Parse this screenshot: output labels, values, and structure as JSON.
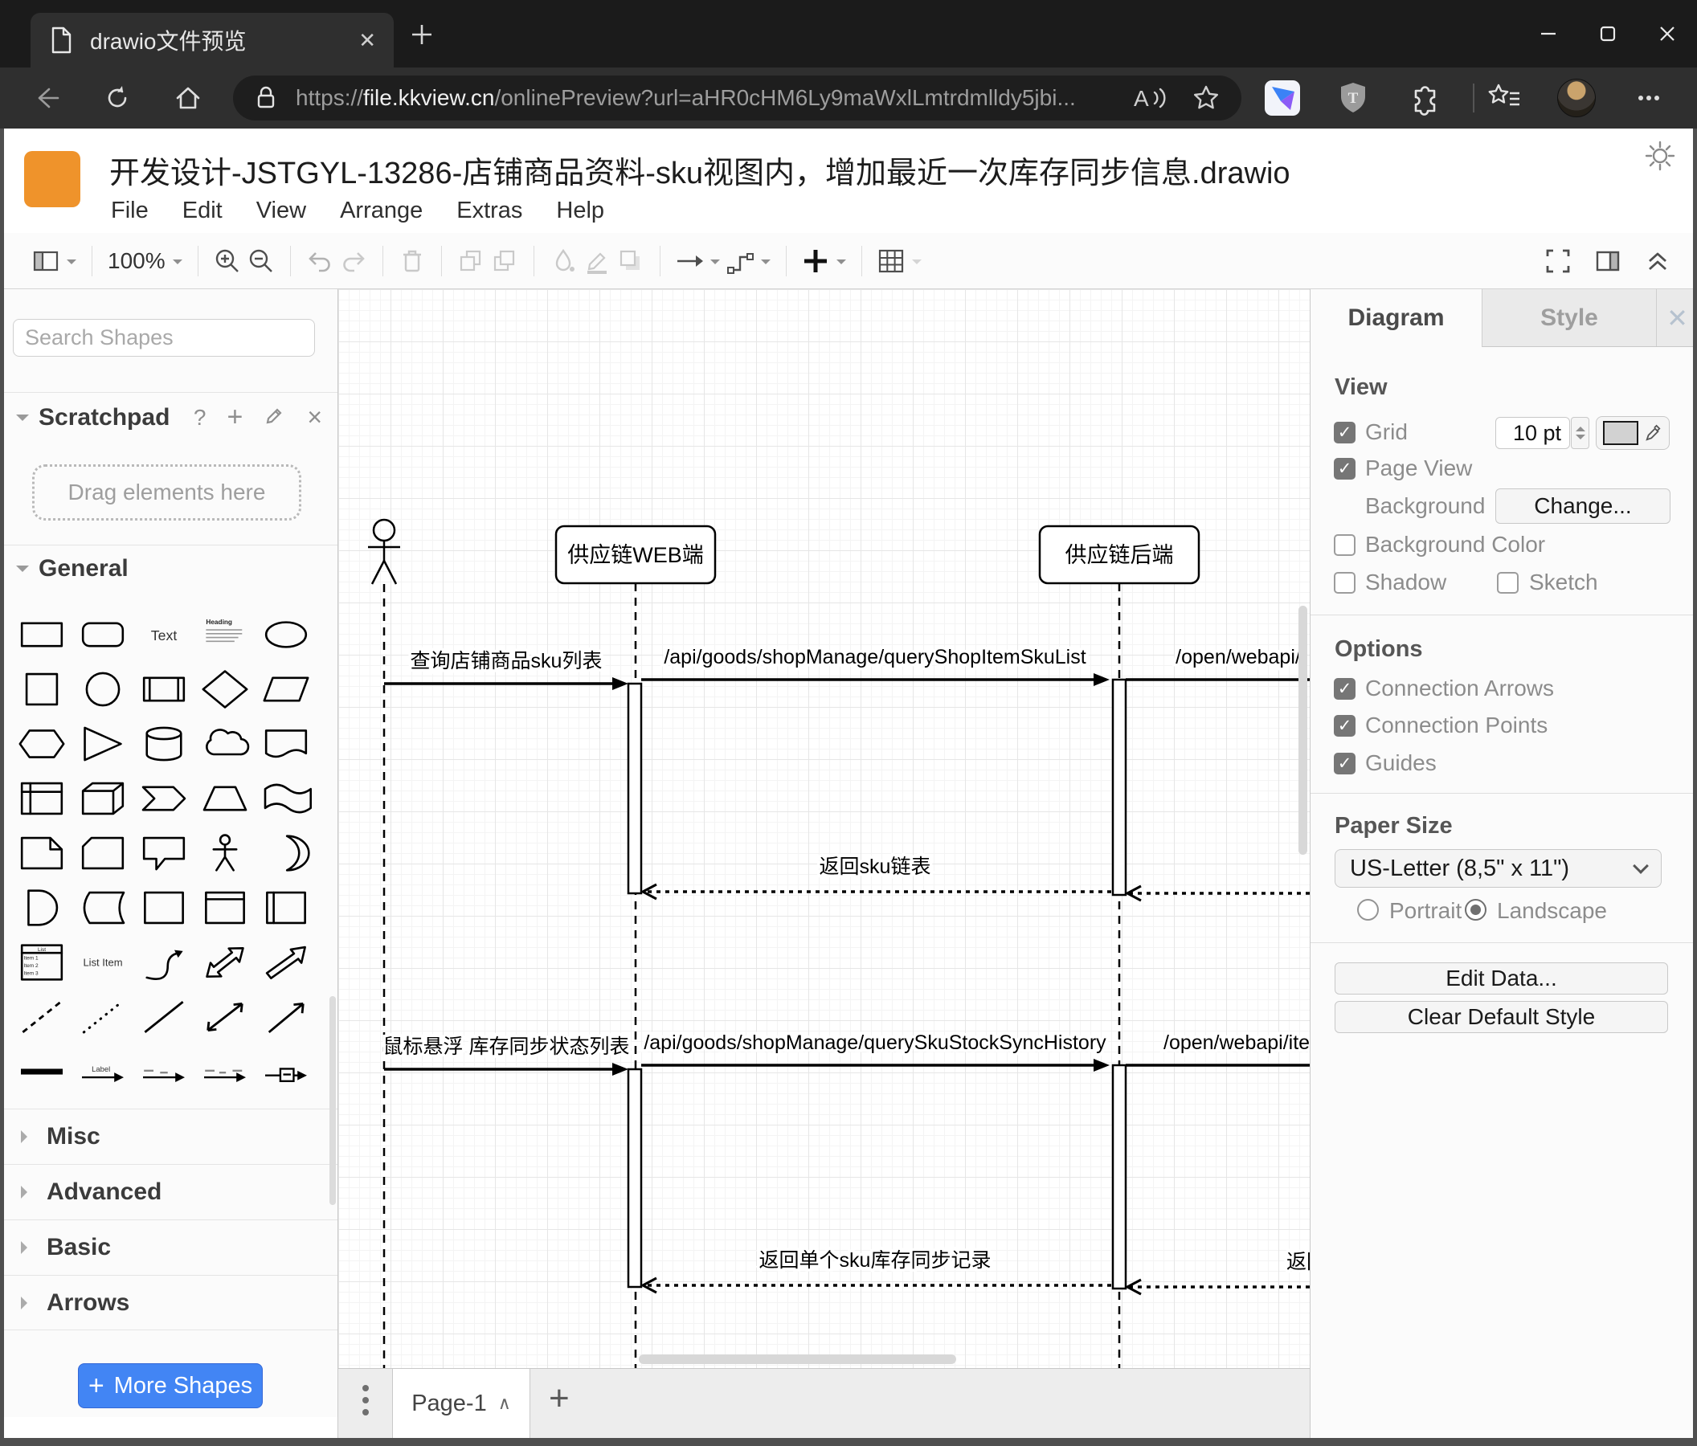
{
  "colors": {
    "logo_orange": "#ef932b",
    "accent_blue": "#4285f4"
  },
  "browser": {
    "tab_title": "drawio文件预览",
    "url": {
      "scheme": "https://",
      "host": "file.kkview.cn",
      "path": "/onlinePreview?url=aHR0cHM6Ly9maWxlLmtrdmlldy5jbi..."
    }
  },
  "app": {
    "title": "开发设计-JSTGYL-13286-店铺商品资料-sku视图内，增加最近一次库存同步信息.drawio",
    "menus": [
      "File",
      "Edit",
      "View",
      "Arrange",
      "Extras",
      "Help"
    ],
    "zoom_level": "100%"
  },
  "sidebar": {
    "search_placeholder": "Search Shapes",
    "scratchpad_title": "Scratchpad",
    "scratchpad_hint": "Drag elements here",
    "sections": [
      "General",
      "Misc",
      "Advanced",
      "Basic",
      "Arrows"
    ],
    "more_shapes_label": "More Shapes",
    "palette_labels": {
      "text": "Text",
      "heading": "Heading",
      "list_title": "List",
      "list_items": [
        "Item 1",
        "Item 2",
        "Item 3"
      ],
      "list_item": "List Item",
      "label": "Label"
    },
    "shapes": [
      "rectangle",
      "rounded-rectangle",
      "text",
      "textbox",
      "ellipse",
      "square",
      "circle",
      "process",
      "diamond",
      "parallelogram",
      "hexagon",
      "triangle",
      "cylinder",
      "cloud",
      "document",
      "internal-storage",
      "cube",
      "step",
      "trapezoid",
      "tape",
      "note",
      "card",
      "callout",
      "actor",
      "or",
      "and",
      "data-storage",
      "container",
      "vertical-container",
      "horizontal-container",
      "list",
      "list-item",
      "curve",
      "bidirectional-arrow",
      "arrow",
      "dashed-line",
      "dotted-line",
      "line",
      "bidirectional-connector",
      "directional-connector",
      "filled-edge",
      "label-arrow",
      "source-arrow",
      "source-target-arrow",
      "link"
    ]
  },
  "canvas": {
    "participants": [
      {
        "type": "actor",
        "label": ""
      },
      {
        "type": "object",
        "label": "供应链WEB端"
      },
      {
        "type": "object",
        "label": "供应链后端"
      }
    ],
    "messages": [
      {
        "from": "user",
        "to": "供应链WEB端",
        "type": "sync",
        "label": "查询店铺商品sku列表"
      },
      {
        "from": "供应链WEB端",
        "to": "供应链后端",
        "type": "sync",
        "label": "/api/goods/shopManage/queryShopItemSkuList"
      },
      {
        "from": "供应链后端",
        "to": "external",
        "type": "sync",
        "label": "/open/webapi/"
      },
      {
        "from": "供应链后端",
        "to": "供应链WEB端",
        "type": "return",
        "label": "返回sku链表"
      },
      {
        "from": "user",
        "to": "供应链WEB端",
        "type": "sync",
        "label": "鼠标悬浮 库存同步状态列表"
      },
      {
        "from": "供应链WEB端",
        "to": "供应链后端",
        "type": "sync",
        "label": "/api/goods/shopManage/querySkuStockSyncHistory"
      },
      {
        "from": "供应链后端",
        "to": "external",
        "type": "sync",
        "label": "/open/webapi/iten"
      },
      {
        "from": "供应链后端",
        "to": "供应链WEB端",
        "type": "return",
        "label": "返回单个sku库存同步记录"
      },
      {
        "from": "external",
        "to": "供应链后端",
        "type": "return",
        "label": "返回"
      }
    ]
  },
  "panel": {
    "tabs": [
      "Diagram",
      "Style"
    ],
    "view": {
      "heading": "View",
      "grid": "Grid",
      "grid_size": "10 pt",
      "page_view": "Page View",
      "background": "Background",
      "change": "Change...",
      "background_color": "Background Color",
      "shadow": "Shadow",
      "sketch": "Sketch"
    },
    "options": {
      "heading": "Options",
      "items": [
        "Connection Arrows",
        "Connection Points",
        "Guides"
      ]
    },
    "paper": {
      "heading": "Paper Size",
      "size": "US-Letter (8,5\" x 11\")",
      "portrait": "Portrait",
      "landscape": "Landscape"
    },
    "edit_data": "Edit Data...",
    "clear_default_style": "Clear Default Style"
  },
  "footer": {
    "page_tab": "Page-1"
  }
}
